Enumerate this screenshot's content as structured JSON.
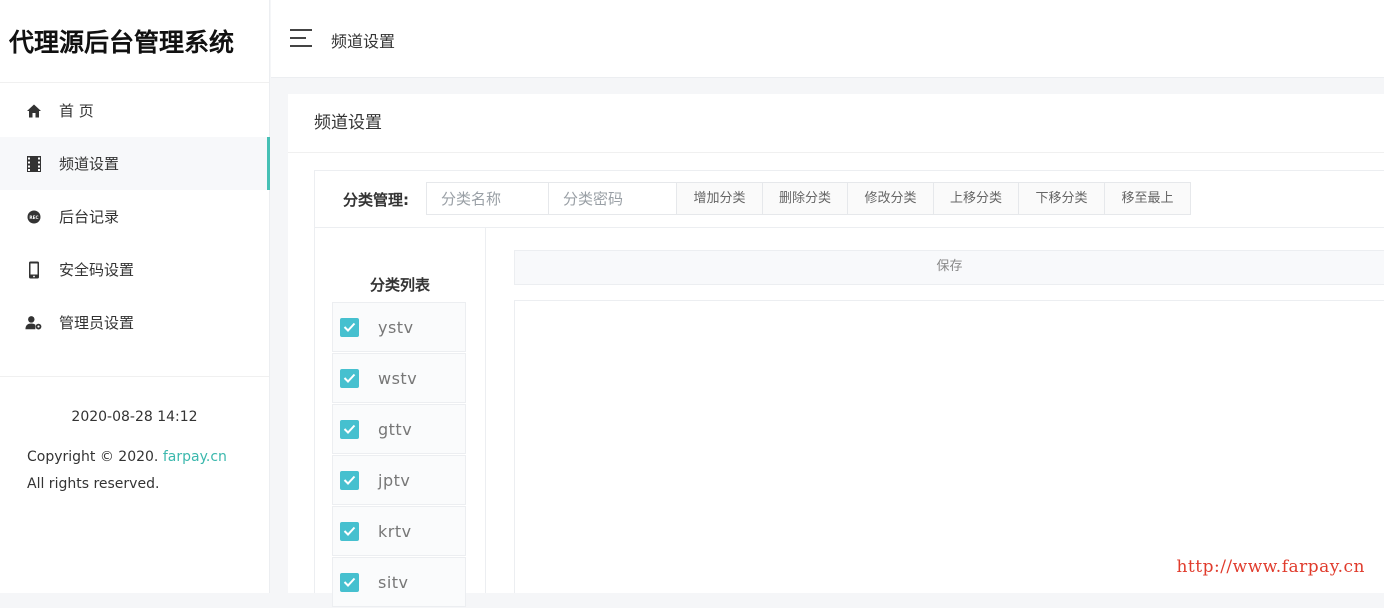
{
  "brand": "代理源后台管理系统",
  "sidebar": {
    "items": [
      {
        "label": "首 页",
        "icon": "home-icon",
        "active": false
      },
      {
        "label": "频道设置",
        "icon": "film-icon",
        "active": true
      },
      {
        "label": "后台记录",
        "icon": "rec-icon",
        "active": false
      },
      {
        "label": "安全码设置",
        "icon": "phone-icon",
        "active": false
      },
      {
        "label": "管理员设置",
        "icon": "user-gear-icon",
        "active": false
      }
    ],
    "date": "2020-08-28 14:12",
    "copyright_prefix": "Copyright © 2020. ",
    "copyright_link": "farpay.cn",
    "rights": "All rights reserved."
  },
  "topbar": {
    "title": "频道设置"
  },
  "panel": {
    "title": "频道设置",
    "toolbar": {
      "label": "分类管理:",
      "name_placeholder": "分类名称",
      "password_placeholder": "分类密码",
      "buttons": [
        "增加分类",
        "删除分类",
        "修改分类",
        "上移分类",
        "下移分类",
        "移至最上"
      ]
    },
    "list_title": "分类列表",
    "list_items": [
      {
        "label": "ystv",
        "checked": true
      },
      {
        "label": "wstv",
        "checked": true
      },
      {
        "label": "gttv",
        "checked": true
      },
      {
        "label": "jptv",
        "checked": true
      },
      {
        "label": "krtv",
        "checked": true
      },
      {
        "label": "sitv",
        "checked": true
      }
    ],
    "save_label": "保存"
  },
  "watermark": "http://www.farpay.cn",
  "colors": {
    "accent": "#46c0b5",
    "checkbox": "#46c0cf",
    "watermark": "#e03b2c",
    "link": "#3bb8ad"
  }
}
